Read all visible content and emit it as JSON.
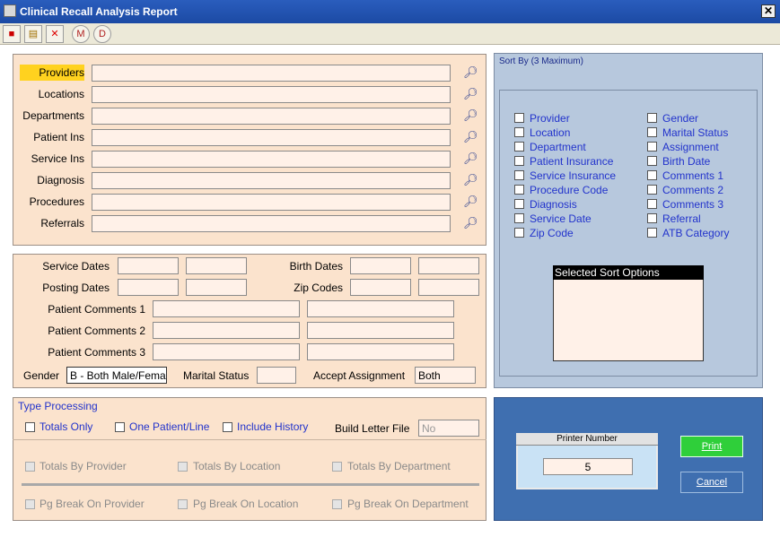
{
  "window": {
    "title": "Clinical Recall Analysis Report",
    "close_label": "✕"
  },
  "toolbar": {
    "buttons": [
      "■",
      "▤",
      "✕",
      "M",
      "D"
    ]
  },
  "filters": {
    "labels": [
      "Providers",
      "Locations",
      "Departments",
      "Patient Ins",
      "Service Ins",
      "Diagnosis",
      "Procedures",
      "Referrals"
    ],
    "values": [
      "",
      "",
      "",
      "",
      "",
      "",
      "",
      ""
    ]
  },
  "ranges": {
    "service_dates": "Service Dates",
    "posting_dates": "Posting Dates",
    "birth_dates": "Birth  Dates",
    "zip_codes": "Zip Codes",
    "comments1": "Patient Comments 1",
    "comments2": "Patient Comments 2",
    "comments3": "Patient Comments 3",
    "gender_label": "Gender",
    "gender_value": "B - Both Male/Fema",
    "marital_label": "Marital Status",
    "marital_value": "",
    "assign_label": "Accept Assignment",
    "assign_value": "Both"
  },
  "type_processing": {
    "title": "Type Processing",
    "totals_only": "Totals Only",
    "one_patient": "One Patient/Line",
    "include_history": "Include History",
    "build_letter": "Build Letter File",
    "build_letter_value": "No",
    "totals_by_provider": "Totals By Provider",
    "totals_by_location": "Totals By Location",
    "totals_by_department": "Totals By Department",
    "pg_break_provider": "Pg Break On Provider",
    "pg_break_location": "Pg Break On Location",
    "pg_break_department": "Pg Break On Department"
  },
  "sort": {
    "title": "Sort By (3 Maximum)",
    "left": [
      "Provider",
      "Location",
      "Department",
      "Patient Insurance",
      "Service Insurance",
      "Procedure Code",
      "Diagnosis",
      "Service Date",
      "Zip Code"
    ],
    "right": [
      "Gender",
      "Marital Status",
      "Assignment",
      "Birth Date",
      "Comments 1",
      "Comments 2",
      "Comments 3",
      "Referral",
      "ATB Category"
    ],
    "selected_title": "Selected Sort Options"
  },
  "printer": {
    "title": "Printer Number",
    "value": "5",
    "print_label": "Print",
    "cancel_label": "Cancel"
  },
  "colors": {
    "accent_highlight": "#ffd21f",
    "link_blue": "#2233cc",
    "print_green": "#2fcf3a"
  }
}
